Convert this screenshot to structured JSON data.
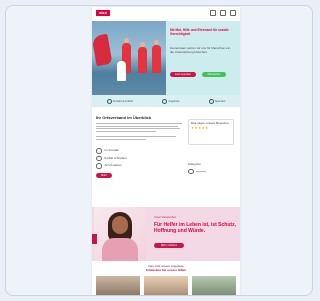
{
  "header": {
    "logo_text": "sixx"
  },
  "hero": {
    "title": "Mit Mut, Hilfe und Ehrenamt für soziale Gerechtigkeit",
    "text": "Gemeinsam setzen wir uns für Menschen ein, die Unterstützung brauchen.",
    "primary_button": "Jetzt spenden",
    "secondary_button": "Mitmachen"
  },
  "tabs": [
    {
      "label": "Kontakt & Anfahrt"
    },
    {
      "label": "Angebote"
    },
    {
      "label": "Spenden"
    }
  ],
  "main": {
    "heading": "Ihr Ortsverband im Überblick",
    "contact_name": "Im Kontakt",
    "contact_email": "E-Mail schreiben",
    "contact_phone": "Anruf starten",
    "cta": "Mehr"
  },
  "sidebar": {
    "rating_title": "Das sagen unsere Besucher",
    "stars": "★★★★★",
    "label": "Kategorie"
  },
  "promo": {
    "kicker": "Unser Versprechen",
    "title": "Für Helfer im Leben ist, ist Schutz, Hoffnung und Würde.",
    "button": "Mehr erfahren"
  },
  "bottom": {
    "subtitle": "Das sind unsere Angebote",
    "title": "Entdecken Sie unsere Hilfen"
  },
  "colors": {
    "brand": "#e2003d",
    "accent": "#c8154c",
    "green": "#42c15a",
    "hero_bg": "#cdeced"
  }
}
